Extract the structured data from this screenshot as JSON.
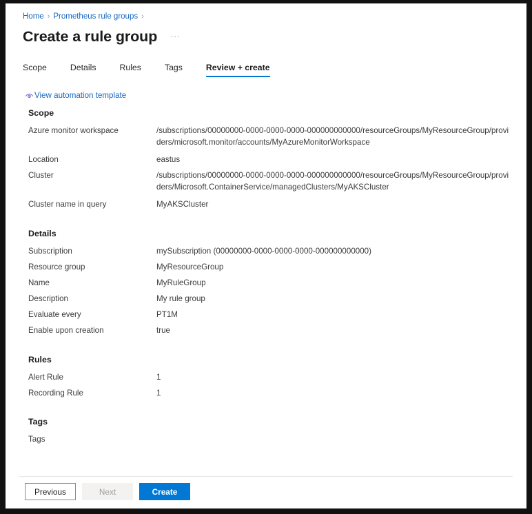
{
  "breadcrumb": {
    "items": [
      "Home",
      "Prometheus rule groups"
    ],
    "separator": "›"
  },
  "header": {
    "title": "Create a rule group",
    "overflow_label": "···"
  },
  "tabs": [
    {
      "label": "Scope",
      "active": false
    },
    {
      "label": "Details",
      "active": false
    },
    {
      "label": "Rules",
      "active": false
    },
    {
      "label": "Tags",
      "active": false
    },
    {
      "label": "Review + create",
      "active": true
    }
  ],
  "automation_link": {
    "label": "View automation template",
    "icon": "view-template-icon"
  },
  "sections": [
    {
      "heading": "Scope",
      "rows": [
        {
          "key": "Azure monitor workspace",
          "value": "/subscriptions/00000000-0000-0000-0000-000000000000/resourceGroups/MyResourceGroup/providers/microsoft.monitor/accounts/MyAzureMonitorWorkspace"
        },
        {
          "key": "Location",
          "value": "eastus"
        },
        {
          "key": "Cluster",
          "value": "/subscriptions/00000000-0000-0000-0000-000000000000/resourceGroups/MyResourceGroup/providers/Microsoft.ContainerService/managedClusters/MyAKSCluster"
        },
        {
          "key": "Cluster name in query",
          "value": "MyAKSCluster"
        }
      ]
    },
    {
      "heading": "Details",
      "rows": [
        {
          "key": "Subscription",
          "value": "mySubscription (00000000-0000-0000-0000-000000000000)"
        },
        {
          "key": "Resource group",
          "value": "MyResourceGroup"
        },
        {
          "key": "Name",
          "value": "MyRuleGroup"
        },
        {
          "key": "Description",
          "value": "My rule group"
        },
        {
          "key": "Evaluate every",
          "value": "PT1M"
        },
        {
          "key": "Enable upon creation",
          "value": "true"
        }
      ]
    },
    {
      "heading": "Rules",
      "rows": [
        {
          "key": "Alert Rule",
          "value": "1"
        },
        {
          "key": "Recording Rule",
          "value": "1"
        }
      ]
    },
    {
      "heading": "Tags",
      "rows": [
        {
          "key": "Tags",
          "value": ""
        }
      ]
    }
  ],
  "footer": {
    "previous_label": "Previous",
    "next_label": "Next",
    "create_label": "Create"
  },
  "colors": {
    "accent": "#0078d4",
    "link": "#1668c1",
    "text": "#3b3b3b",
    "heading": "#1b1b1b",
    "disabled": "#a19f9d"
  }
}
